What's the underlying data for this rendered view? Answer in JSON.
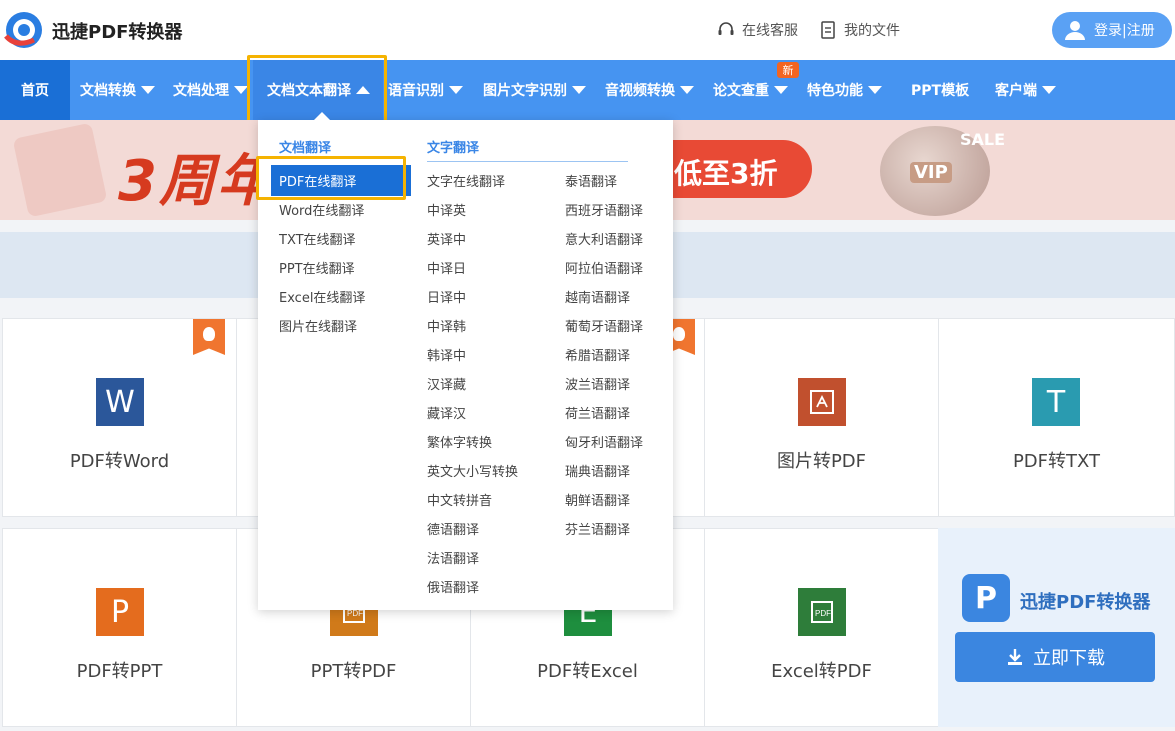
{
  "header": {
    "app_name": "迅捷PDF转换器",
    "service_label": "在线客服",
    "files_label": "我的文件",
    "login_label": "登录|注册"
  },
  "nav": {
    "items": [
      {
        "label": "首页"
      },
      {
        "label": "文档转换"
      },
      {
        "label": "文档处理"
      },
      {
        "label": "文档文本翻译"
      },
      {
        "label": "语音识别"
      },
      {
        "label": "图片文字识别"
      },
      {
        "label": "音视频转换"
      },
      {
        "label": "论文查重"
      },
      {
        "label": "特色功能"
      },
      {
        "label": "PPT模板"
      },
      {
        "label": "客户端"
      }
    ],
    "new_badge": "新"
  },
  "banner": {
    "main_text": "3周年",
    "pill_text": "低至3折",
    "vip": "VIP",
    "sale": "SALE"
  },
  "dropdown": {
    "col1_title": "文档翻译",
    "col1_items": [
      "PDF在线翻译",
      "Word在线翻译",
      "TXT在线翻译",
      "PPT在线翻译",
      "Excel在线翻译",
      "图片在线翻译"
    ],
    "col2_title": "文字翻译",
    "col2_items": [
      "文字在线翻译",
      "中译英",
      "英译中",
      "中译日",
      "日译中",
      "中译韩",
      "韩译中",
      "汉译藏",
      "藏译汉",
      "繁体字转换",
      "英文大小写转换",
      "中文转拼音",
      "德语翻译",
      "法语翻译",
      "俄语翻译"
    ],
    "col3_items": [
      "泰语翻译",
      "西班牙语翻译",
      "意大利语翻译",
      "阿拉伯语翻译",
      "越南语翻译",
      "葡萄牙语翻译",
      "希腊语翻译",
      "波兰语翻译",
      "荷兰语翻译",
      "匈牙利语翻译",
      "瑞典语翻译",
      "朝鲜语翻译",
      "芬兰语翻译"
    ]
  },
  "tools": {
    "row1": [
      {
        "label": "PDF转Word",
        "icon": "W",
        "color": "#2b579a"
      },
      {
        "label": "图片转PDF",
        "icon": "pdf-icon",
        "color": "#c1502e"
      },
      {
        "label": "PDF转TXT",
        "icon": "T",
        "color": "#2a9bb0"
      }
    ],
    "row2": [
      {
        "label": "PDF转PPT",
        "icon": "P",
        "color": "#e46c1e"
      },
      {
        "label": "PPT转PDF",
        "icon": "pdf-icon",
        "color": "#d07a1a"
      },
      {
        "label": "PDF转Excel",
        "icon": "E",
        "color": "#1e8e3e"
      },
      {
        "label": "Excel转PDF",
        "icon": "pdf-icon",
        "color": "#2e7d3a"
      }
    ]
  },
  "download": {
    "app_name": "迅捷PDF转换器",
    "button_label": "立即下载"
  }
}
